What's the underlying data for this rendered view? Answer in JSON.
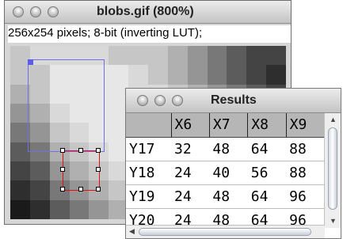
{
  "image_window": {
    "title": "blobs.gif (800%)",
    "info": "256x254 pixels; 8-bit (inverting LUT);"
  },
  "results_window": {
    "title": "Results",
    "columns": [
      "X6",
      "X7",
      "X8",
      "X9"
    ],
    "rows": [
      {
        "label": "Y17",
        "values": [
          "32",
          "48",
          "64",
          "88"
        ]
      },
      {
        "label": "Y18",
        "values": [
          "24",
          "40",
          "56",
          "88"
        ]
      },
      {
        "label": "Y19",
        "values": [
          "24",
          "48",
          "64",
          "96"
        ]
      },
      {
        "label": "Y20",
        "values": [
          "24",
          "48",
          "64",
          "96"
        ]
      }
    ]
  },
  "colors": {
    "roi_blue": "#6f6fe6",
    "roi_red": "#e01010"
  }
}
